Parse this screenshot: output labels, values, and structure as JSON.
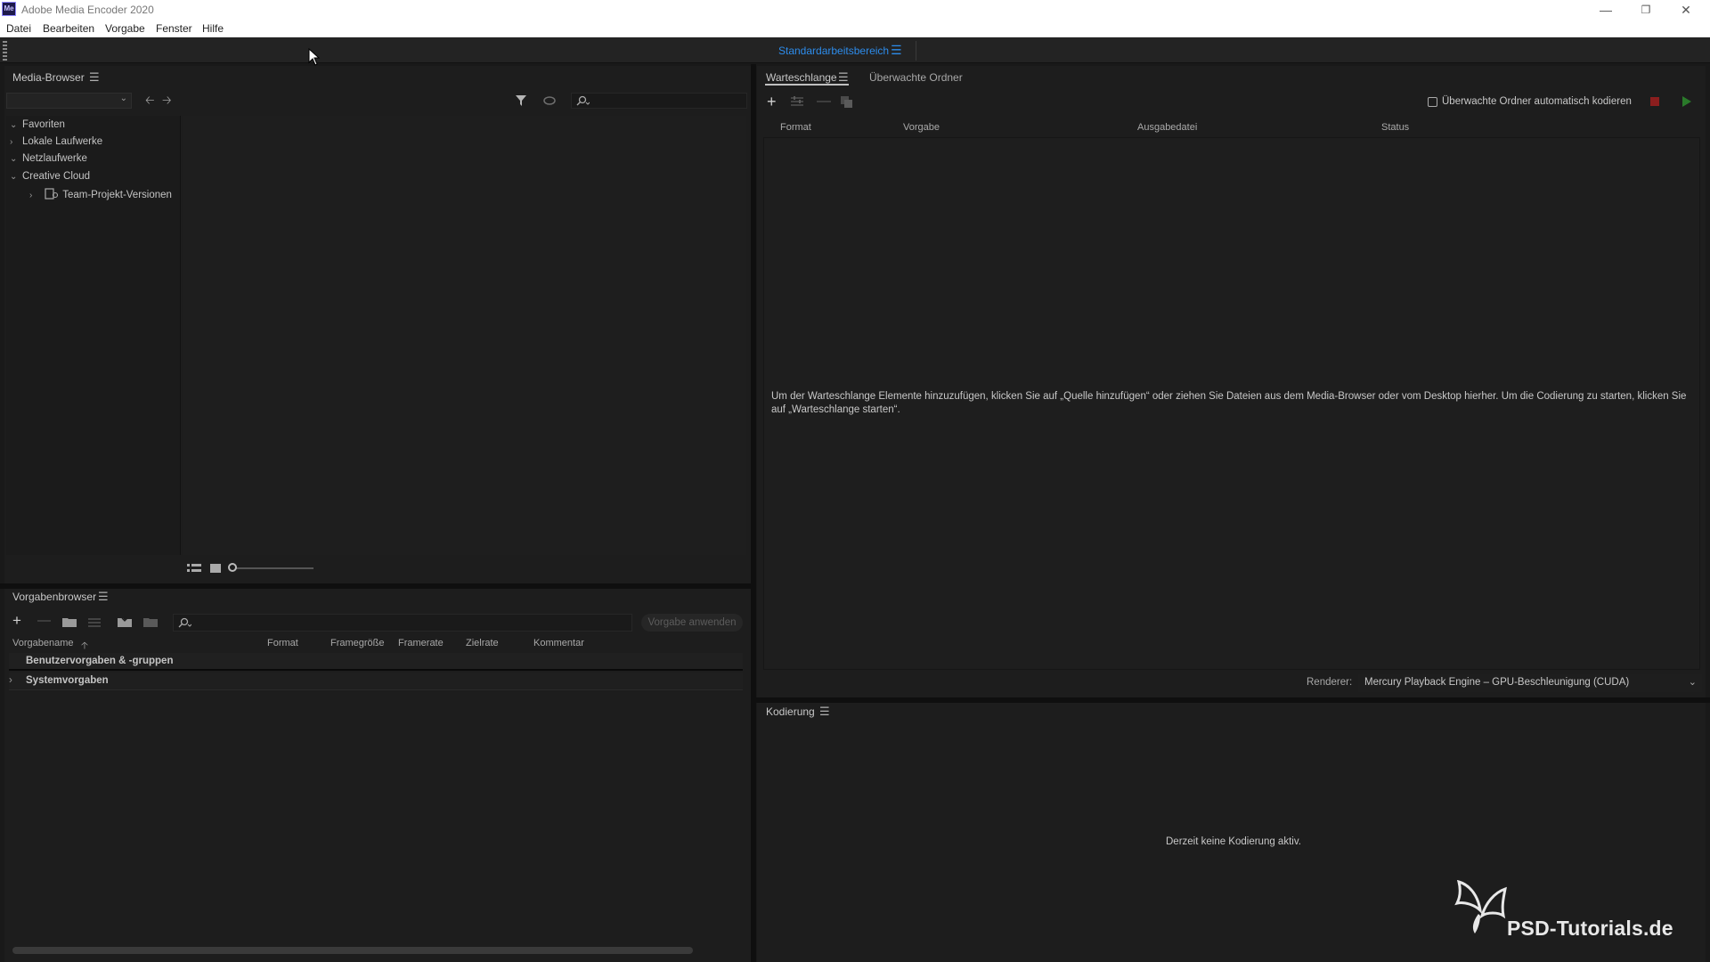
{
  "window": {
    "icon_label": "Me",
    "title": "Adobe Media Encoder 2020"
  },
  "menu": [
    "Datei",
    "Bearbeiten",
    "Vorgabe",
    "Fenster",
    "Hilfe"
  ],
  "workspace": {
    "label": "Standardarbeitsbereich"
  },
  "media_browser": {
    "title": "Media-Browser",
    "tree": [
      {
        "label": "Favoriten",
        "expanded": true
      },
      {
        "label": "Lokale Laufwerke",
        "expanded": false
      },
      {
        "label": "Netzlaufwerke",
        "expanded": true
      },
      {
        "label": "Creative Cloud",
        "expanded": true
      },
      {
        "label": "Team-Projekt-Versionen",
        "expanded": false
      }
    ],
    "search_value": ""
  },
  "queue": {
    "tabs": [
      "Warteschlange",
      "Überwachte Ordner"
    ],
    "auto_encode_label": "Überwachte Ordner automatisch kodieren",
    "columns": [
      "Format",
      "Vorgabe",
      "Ausgabedatei",
      "Status"
    ],
    "empty_message": "Um der Warteschlange Elemente hinzuzufügen, klicken Sie auf „Quelle hinzufügen“ oder ziehen Sie Dateien aus dem Media-Browser oder vom Desktop hierher. Um die Codierung zu starten, klicken Sie auf „Warteschlange starten“.",
    "renderer_label": "Renderer:",
    "renderer_value": "Mercury Playback Engine – GPU-Beschleunigung (CUDA)"
  },
  "preset_browser": {
    "title": "Vorgabenbrowser",
    "apply_label": "Vorgabe anwenden",
    "columns": [
      "Vorgabename",
      "Format",
      "Framegröße",
      "Framerate",
      "Zielrate",
      "Kommentar"
    ],
    "rows": [
      "Benutzervorgaben & -gruppen",
      "Systemvorgaben"
    ],
    "search_value": ""
  },
  "encoding": {
    "title": "Kodierung",
    "idle_message": "Derzeit keine Kodierung aktiv."
  },
  "watermark": {
    "text": "PSD-Tutorials.de"
  },
  "colors": {
    "accent": "#2d8ceb",
    "stop": "#8b1e1e",
    "play": "#2a7a2a"
  }
}
